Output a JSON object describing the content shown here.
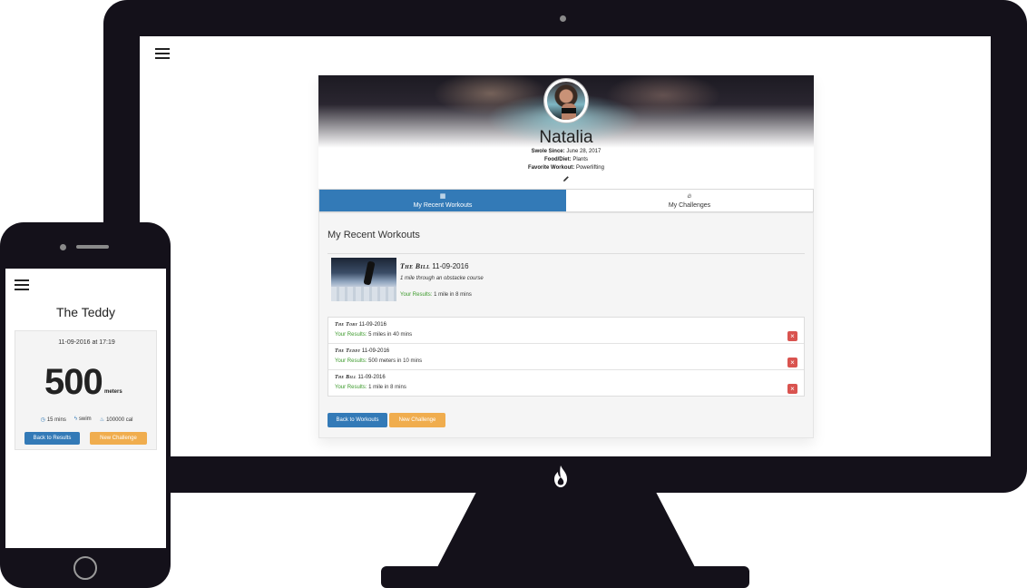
{
  "desktop": {
    "profile": {
      "name": "Natalia",
      "swole_since_label": "Swole Since:",
      "swole_since": "June 28, 2017",
      "food_label": "Food/Diet:",
      "food": "Plants",
      "favorite_label": "Favorite Workout:",
      "favorite": "Powerlifting"
    },
    "tabs": [
      {
        "label": "My Recent Workouts",
        "icon": "calendar-icon",
        "active": true
      },
      {
        "label": "My Challenges",
        "icon": "flame-icon",
        "active": false
      }
    ],
    "section_title": "My Recent Workouts",
    "featured": {
      "name": "The Bill",
      "date": "11-09-2016",
      "description": "1 mile through an obstacke course",
      "result_label": "Your Results:",
      "result": "1 mile in 8 mins"
    },
    "workouts": [
      {
        "name": "The Toby",
        "date": "11-09-2016",
        "result_label": "Your Results:",
        "result": "5 miles in 40 mins",
        "delete": "×"
      },
      {
        "name": "The Teddy",
        "date": "11-09-2016",
        "result_label": "Your Results:",
        "result": "500 meters in 10 mins",
        "delete": "×"
      },
      {
        "name": "The Bill",
        "date": "11-09-2016",
        "result_label": "Your Results:",
        "result": "1 mile in 8 mins",
        "delete": "×"
      }
    ],
    "buttons": {
      "back_to_workouts": "Back to Workouts",
      "new_challenge": "New Challenge"
    }
  },
  "phone": {
    "title": "The Teddy",
    "timestamp": "11-09-2016 at 17:19",
    "value": "500",
    "unit": "meters",
    "duration": "15 mins",
    "activity": "swim",
    "calories": "100000 cal",
    "buttons": {
      "back_to_results": "Back to Results",
      "new_challenge": "New Challenge"
    }
  },
  "colors": {
    "primary": "#337ab7",
    "warning": "#f0ad4e",
    "danger": "#d9534f",
    "success_text": "#3c9a2c",
    "device_frame": "#14111a"
  }
}
